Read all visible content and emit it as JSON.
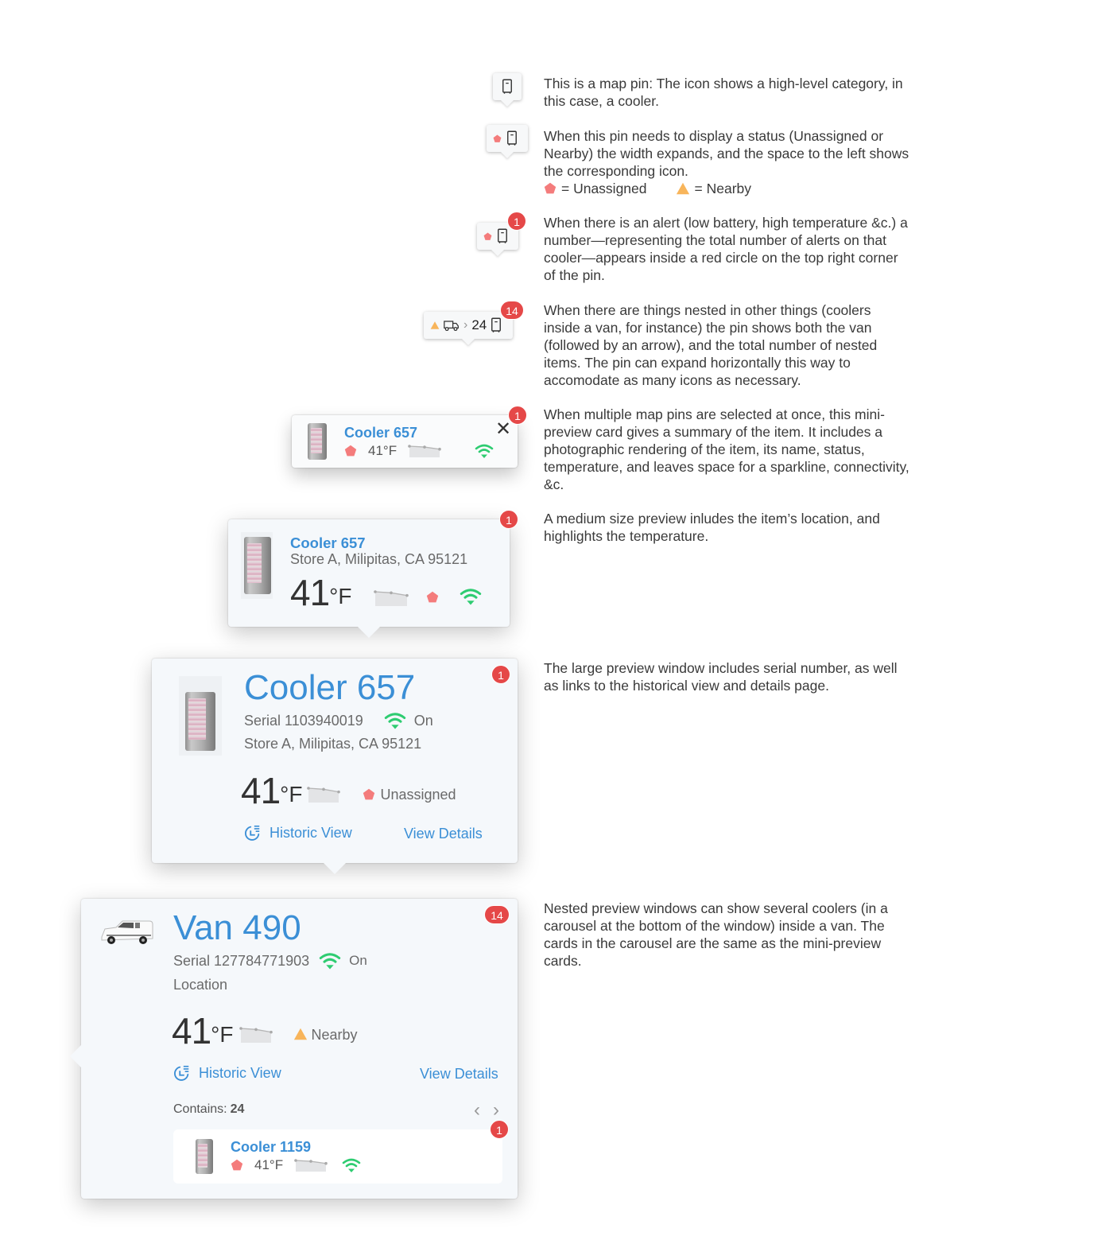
{
  "colors": {
    "accent_blue": "#3b8fd6",
    "alert_red": "#e54848",
    "unassigned_pink": "#f47c7c",
    "nearby_orange": "#f8b55b",
    "wifi_green": "#2ecc71",
    "card_bg": "#f5f8fb"
  },
  "descriptions": {
    "pin_basic": "This is a map pin: The icon shows a high-level category, in this case, a cooler.",
    "pin_status": "When this pin needs to display a status (Unassigned or Nearby) the width expands, and the space to the left shows the corresponding icon.",
    "legend_unassigned": "= Unassigned",
    "legend_nearby": "= Nearby",
    "pin_alert": "When there is an alert (low battery, high temperature &c.) a number—representing the total number of alerts on that cooler—appears inside a red circle on the top right corner of the pin.",
    "pin_nested": "When there are things nested in other things (coolers inside a van, for instance) the pin shows both the van (followed by an arrow), and the total number of nested items. The pin can expand horizontally this way to accomodate as many icons as necessary.",
    "mini_preview": "When multiple map pins are selected at once, this mini-preview card gives a summary of the item. It includes a photographic rendering of the item, its name, status, temperature, and leaves space for a sparkline, connectivity, &c.",
    "medium_preview": "A medium size preview inludes the item’s location, and highlights the temperature.",
    "large_preview": "The large preview window includes serial number, as well as links to the historical view and details page.",
    "nested_preview": "Nested preview windows can show several coolers (in a carousel at the bottom of the window) inside a van. The cards in the carousel are the same as the mini-preview cards."
  },
  "pins": {
    "alert_pin": {
      "badge": "1"
    },
    "nested_pin": {
      "count": "24",
      "badge": "14",
      "status_icon": "nearby-triangle",
      "vehicle_icon": "truck-icon",
      "item_icon": "cooler-icon"
    }
  },
  "mini_card": {
    "name": "Cooler 657",
    "temperature": "41°F",
    "status_icon": "unassigned-pentagon",
    "badge": "1",
    "close_icon": "close-icon",
    "sparkline": [
      3,
      2.6,
      1.6
    ]
  },
  "medium_card": {
    "name": "Cooler 657",
    "location": "Store A, Milipitas, CA 95121",
    "temp_value": "41",
    "temp_unit": "°F",
    "badge": "1",
    "sparkline": [
      3,
      2.6,
      1.6
    ]
  },
  "large_card": {
    "name": "Cooler 657",
    "serial": "Serial 1103940019",
    "connectivity": "On",
    "location": "Store A, Milipitas, CA 95121",
    "temp_value": "41",
    "temp_unit": "°F",
    "status": "Unassigned",
    "historic_link": "Historic View",
    "details_link": "View Details",
    "badge": "1",
    "sparkline": [
      3,
      2.6,
      1.6
    ]
  },
  "van_card": {
    "name": "Van 490",
    "serial": "Serial 127784771903",
    "connectivity": "On",
    "location": "Location",
    "temp_value": "41",
    "temp_unit": "°F",
    "status": "Nearby",
    "historic_link": "Historic View",
    "details_link": "View Details",
    "contains_label": "Contains:",
    "contains_count": "24",
    "badge": "14",
    "sparkline": [
      3,
      2.6,
      1.6
    ],
    "carousel": {
      "items": [
        {
          "name": "Cooler 1159",
          "temperature": "41°F",
          "badge": "1",
          "sparkline": [
            3,
            2.6,
            1.6
          ]
        }
      ]
    }
  }
}
